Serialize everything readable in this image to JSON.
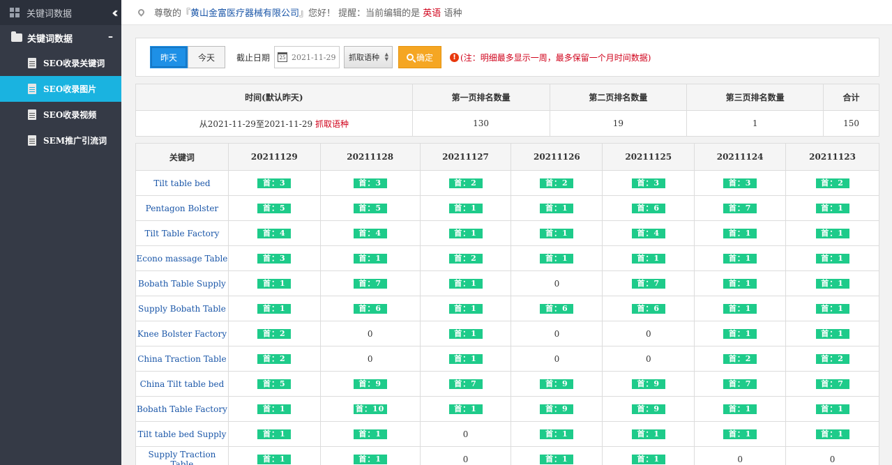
{
  "sidebar": {
    "header_title": "关键词数据",
    "collapse_icon": "double-chevron-left-icon",
    "group_label": "关键词数据",
    "group_toggle": "–",
    "items": [
      {
        "label": "SEO收录关键词",
        "active": false
      },
      {
        "label": "SEO收录图片",
        "active": true
      },
      {
        "label": "SEO收录视频",
        "active": false
      },
      {
        "label": "SEM推广引流词",
        "active": false
      }
    ]
  },
  "topbar": {
    "prefix": "尊敬的『",
    "company": "黄山金富医疗器械有限公司",
    "middle": "』您好！ 提醒：当前编辑的是 ",
    "language": "英语",
    "suffix": " 语种"
  },
  "filter": {
    "tab_yesterday": "昨天",
    "tab_today": "今天",
    "date_label": "截止日期",
    "date_value": "2021-11-29",
    "calendar_day": "25",
    "select_value": "抓取语种",
    "confirm_label": "确定",
    "note": "(注：明细最多显示一周，最多保留一个月时间数据)"
  },
  "summary": {
    "headers": [
      "时间(默认昨天)",
      "第一页排名数量",
      "第二页排名数量",
      "第三页排名数量",
      "合计"
    ],
    "range_text": "从2021-11-29至2021-11-29 ",
    "range_lang": "抓取语种",
    "page1": "130",
    "page2": "19",
    "page3": "1",
    "total": "150"
  },
  "table": {
    "headers": [
      "关键词",
      "20211129",
      "20211128",
      "20211127",
      "20211126",
      "20211125",
      "20211124",
      "20211123"
    ],
    "rows": [
      {
        "keyword": "Tilt table bed",
        "cells": [
          "首：3",
          "首：3",
          "首：2",
          "首：2",
          "首：3",
          "首：3",
          "首：2"
        ]
      },
      {
        "keyword": "Pentagon Bolster",
        "cells": [
          "首：5",
          "首：5",
          "首：1",
          "首：1",
          "首：6",
          "首：7",
          "首：1"
        ]
      },
      {
        "keyword": "Tilt Table Factory",
        "cells": [
          "首：4",
          "首：4",
          "首：1",
          "首：1",
          "首：4",
          "首：1",
          "首：1"
        ]
      },
      {
        "keyword": "Econo massage Table",
        "cells": [
          "首：3",
          "首：1",
          "首：2",
          "首：1",
          "首：1",
          "首：1",
          "首：1"
        ]
      },
      {
        "keyword": "Bobath Table Supply",
        "cells": [
          "首：1",
          "首：7",
          "首：1",
          "0",
          "首：7",
          "首：1",
          "首：1"
        ]
      },
      {
        "keyword": "Supply Bobath Table",
        "cells": [
          "首：1",
          "首：6",
          "首：1",
          "首：6",
          "首：6",
          "首：1",
          "首：1"
        ]
      },
      {
        "keyword": "Knee Bolster Factory",
        "cells": [
          "首：2",
          "0",
          "首：1",
          "0",
          "0",
          "首：1",
          "首：1"
        ]
      },
      {
        "keyword": "China Traction Table",
        "cells": [
          "首：2",
          "0",
          "首：1",
          "0",
          "0",
          "首：2",
          "首：2"
        ]
      },
      {
        "keyword": "China Tilt table bed",
        "cells": [
          "首：5",
          "首：9",
          "首：7",
          "首：9",
          "首：9",
          "首：7",
          "首：7"
        ]
      },
      {
        "keyword": "Bobath Table Factory",
        "cells": [
          "首：1",
          "首：10",
          "首：1",
          "首：9",
          "首：9",
          "首：1",
          "首：1"
        ]
      },
      {
        "keyword": "Tilt table bed Supply",
        "cells": [
          "首：1",
          "首：1",
          "0",
          "首：1",
          "首：1",
          "首：1",
          "首：1"
        ]
      },
      {
        "keyword": "Supply Traction Table",
        "cells": [
          "首：1",
          "首：1",
          "0",
          "首：1",
          "首：1",
          "0",
          "0"
        ]
      }
    ]
  },
  "colors": {
    "sidebar_bg": "#353a46",
    "active_item": "#1ab3e0",
    "badge_green": "#1ecb8a",
    "confirm_orange": "#f5a623",
    "alert_red": "#d0021b"
  }
}
